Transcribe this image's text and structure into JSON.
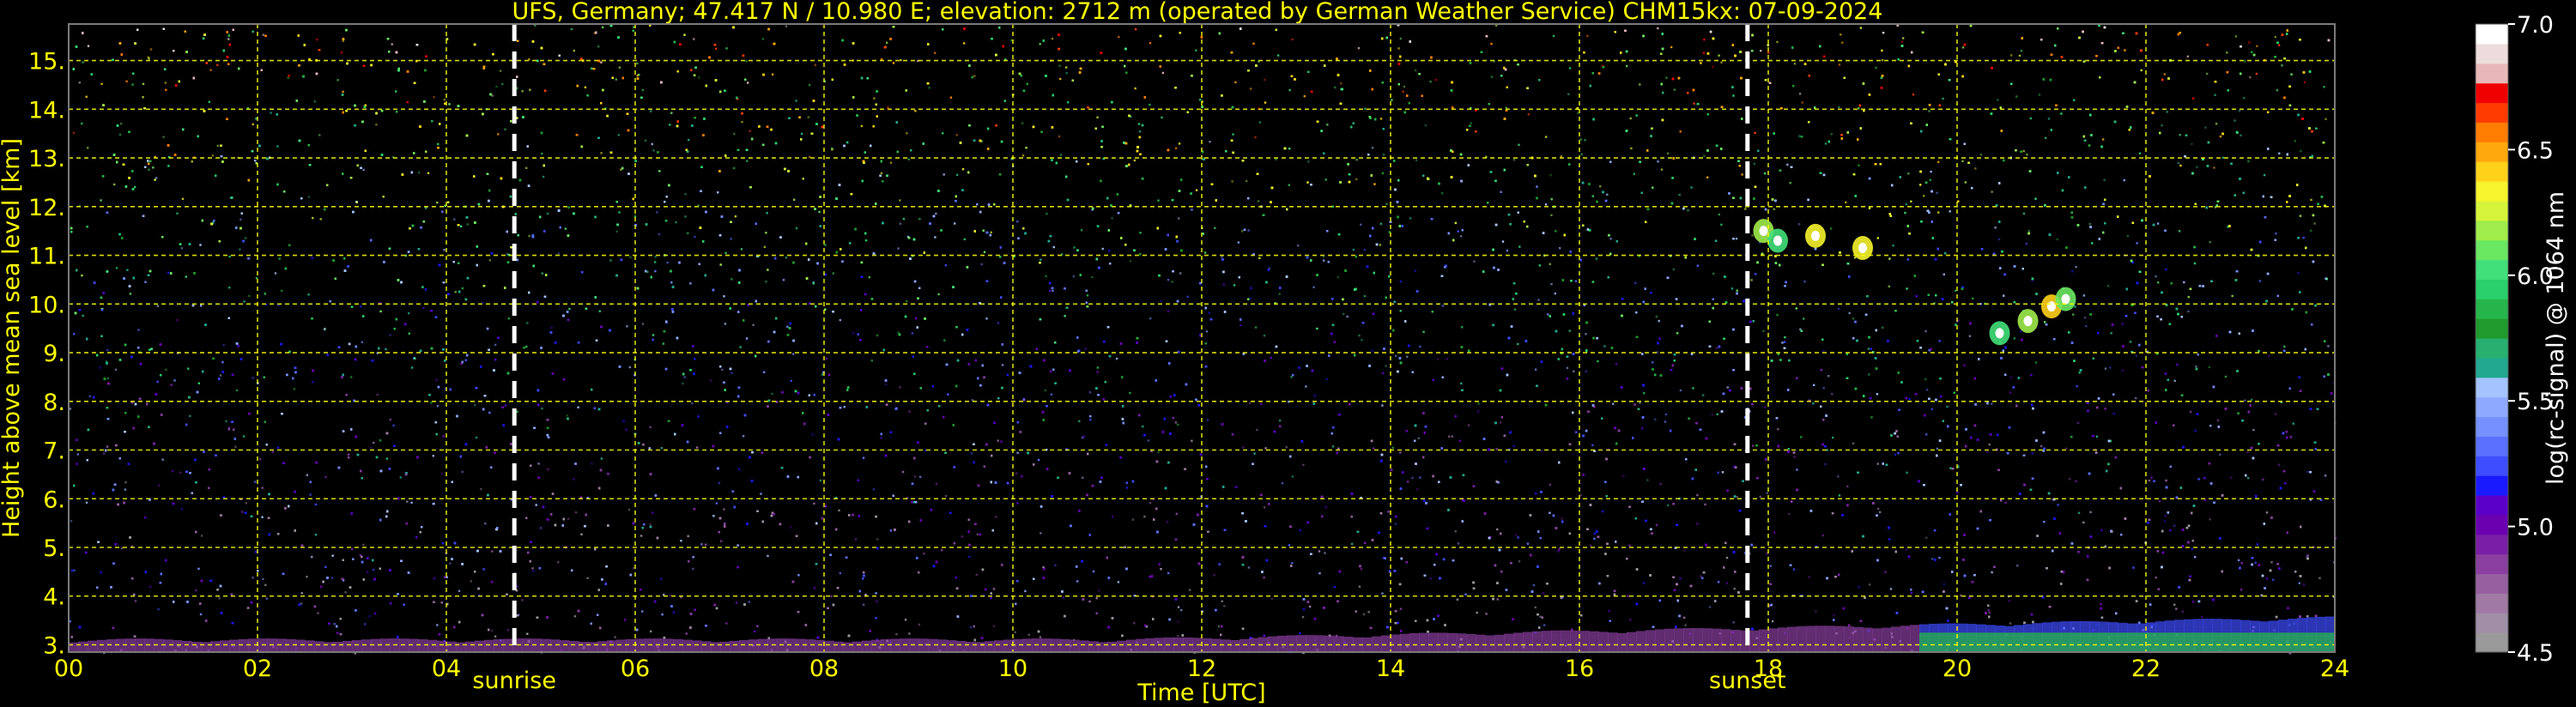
{
  "chart_data": {
    "type": "heatmap",
    "title": "UFS, Germany; 47.417 N / 10.980 E; elevation: 2712 m  (operated by German Weather Service)    CHM15kx: 07-09-2024",
    "xlabel": "Time [UTC]",
    "ylabel": "Height above mean sea level [km]",
    "xlim": [
      0,
      24
    ],
    "ylim": [
      2.85,
      15.75
    ],
    "x_ticks": [
      "00",
      "02",
      "04",
      "06",
      "08",
      "10",
      "12",
      "14",
      "16",
      "18",
      "20",
      "22",
      "24"
    ],
    "y_ticks": [
      "3.",
      "4.",
      "5.",
      "6.",
      "7.",
      "8.",
      "9.",
      "10.",
      "11.",
      "12.",
      "13.",
      "14.",
      "15."
    ],
    "grid": true,
    "colorbar": {
      "label": "log(rc-signal) @ 1064 nm",
      "range": [
        4.5,
        7.0
      ],
      "ticks": [
        "4.5",
        "5.0",
        "5.5",
        "6.0",
        "6.5",
        "7.0"
      ],
      "colors": [
        "#9a9a9a",
        "#a08fa6",
        "#a07aa4",
        "#9660a0",
        "#8a3fa0",
        "#7a1fa5",
        "#6a00b0",
        "#5a00c8",
        "#1a1aff",
        "#3e4dff",
        "#5a70ff",
        "#7590ff",
        "#8eaaff",
        "#a5c4ff",
        "#22a890",
        "#27b070",
        "#1f9a2c",
        "#26b54a",
        "#2ad06a",
        "#42e07a",
        "#6ae862",
        "#a0ec4a",
        "#d6f43a",
        "#f6f42c",
        "#ffd21a",
        "#ffa80c",
        "#ff7d00",
        "#ff3c00",
        "#f00000",
        "#e8b8b8",
        "#eedcdc",
        "#ffffff"
      ]
    },
    "markers": [
      {
        "label": "sunrise",
        "x": 4.72
      },
      {
        "label": "sunset",
        "x": 17.78
      }
    ],
    "cloud_patches": [
      {
        "t": 17.95,
        "h": 11.5,
        "v": 6.2
      },
      {
        "t": 18.1,
        "h": 11.3,
        "v": 6.0
      },
      {
        "t": 18.5,
        "h": 11.4,
        "v": 6.3
      },
      {
        "t": 19.0,
        "h": 11.15,
        "v": 6.3
      },
      {
        "t": 20.45,
        "h": 9.4,
        "v": 6.0
      },
      {
        "t": 20.75,
        "h": 9.65,
        "v": 6.2
      },
      {
        "t": 21.0,
        "h": 9.95,
        "v": 6.4
      },
      {
        "t": 21.15,
        "h": 10.1,
        "v": 6.1
      }
    ]
  }
}
